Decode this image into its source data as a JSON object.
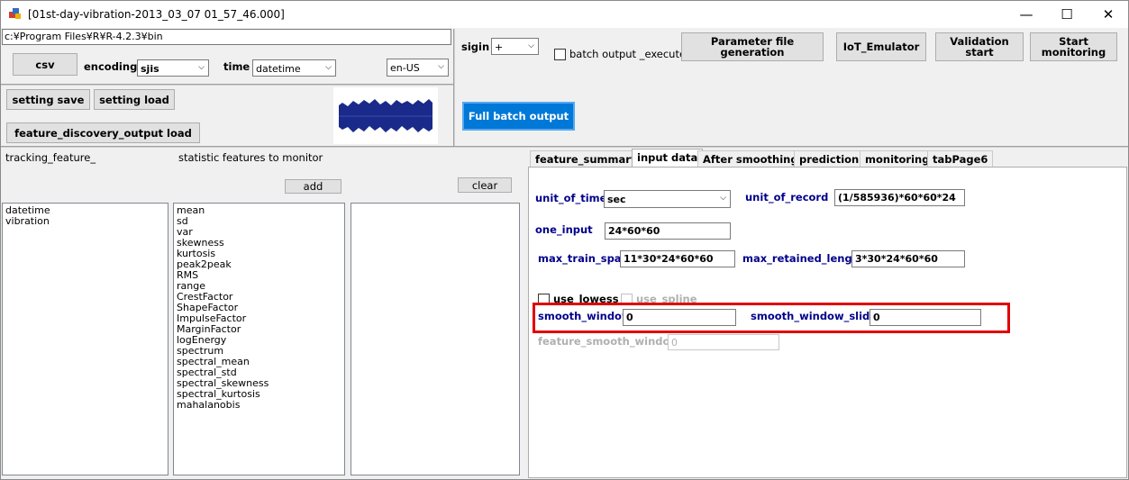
{
  "window": {
    "title": "[01st-day-vibration-2013_03_07 01_57_46.000]",
    "minimize": "—",
    "maximize": "☐",
    "close": "✕"
  },
  "path": {
    "value": "c:¥Program Files¥R¥R-4.2.3¥bin"
  },
  "top_left": {
    "csv": "csv",
    "encoding_label": "encoding",
    "encoding_value": "sjis",
    "time_label": "time",
    "time_value": "datetime",
    "locale_value": "en-US",
    "setting_save": "setting save",
    "setting_load": "setting load",
    "feature_discovery_load": "feature_discovery_output load"
  },
  "top_mid": {
    "sigin_label": "sigin",
    "sigin_value": "+",
    "batch_execute_label": "batch output _execute",
    "full_batch_output": "Full batch output"
  },
  "top_right": {
    "param_file_gen": "Parameter file generation",
    "iot_emulator": "IoT_Emulator",
    "validation_start": "Validation start",
    "start_monitoring": "Start monitoring"
  },
  "left_panel": {
    "tracking_label": "tracking_feature_",
    "stat_label": "statistic features to monitor",
    "add": "add",
    "clear": "clear",
    "tracking_items": [
      "datetime",
      "vibration"
    ],
    "stat_items": [
      "mean",
      "sd",
      "var",
      "skewness",
      "kurtosis",
      "peak2peak",
      "RMS",
      "range",
      "CrestFactor",
      "ShapeFactor",
      "ImpulseFactor",
      "MarginFactor",
      "logEnergy",
      "spectrum",
      "spectral_mean",
      "spectral_std",
      "spectral_skewness",
      "spectral_kurtosis",
      "mahalanobis"
    ]
  },
  "tabs": [
    "feature_summary",
    "input data",
    "After smoothing",
    "prediction",
    "monitoring",
    "tabPage6"
  ],
  "active_tab": "input data",
  "input_data": {
    "unit_of_time_label": "unit_of_time",
    "unit_of_time_value": "sec",
    "unit_of_record_label": "unit_of_record",
    "unit_of_record_value": "(1/585936)*60*60*24",
    "one_input_label": "one_input",
    "one_input_value": "24*60*60",
    "max_train_span_label": "max_train_span",
    "max_train_span_value": "11*30*24*60*60",
    "max_retained_length_label": "max_retained_length",
    "max_retained_length_value": "3*30*24*60*60",
    "use_lowess_label": "use_lowess",
    "use_spline_label": "use_spline",
    "smooth_window_label": "smooth_window",
    "smooth_window_value": "0",
    "smooth_window_slide_label": "smooth_window_slide",
    "smooth_window_slide_value": "0",
    "feature_smooth_window_label": "feature_smooth_window",
    "feature_smooth_window_value": "0"
  },
  "colors": {
    "accent": "#0078d7",
    "highlight": "#e00000",
    "label_blue": "#00008b",
    "waveform": "#1a2a8a"
  }
}
